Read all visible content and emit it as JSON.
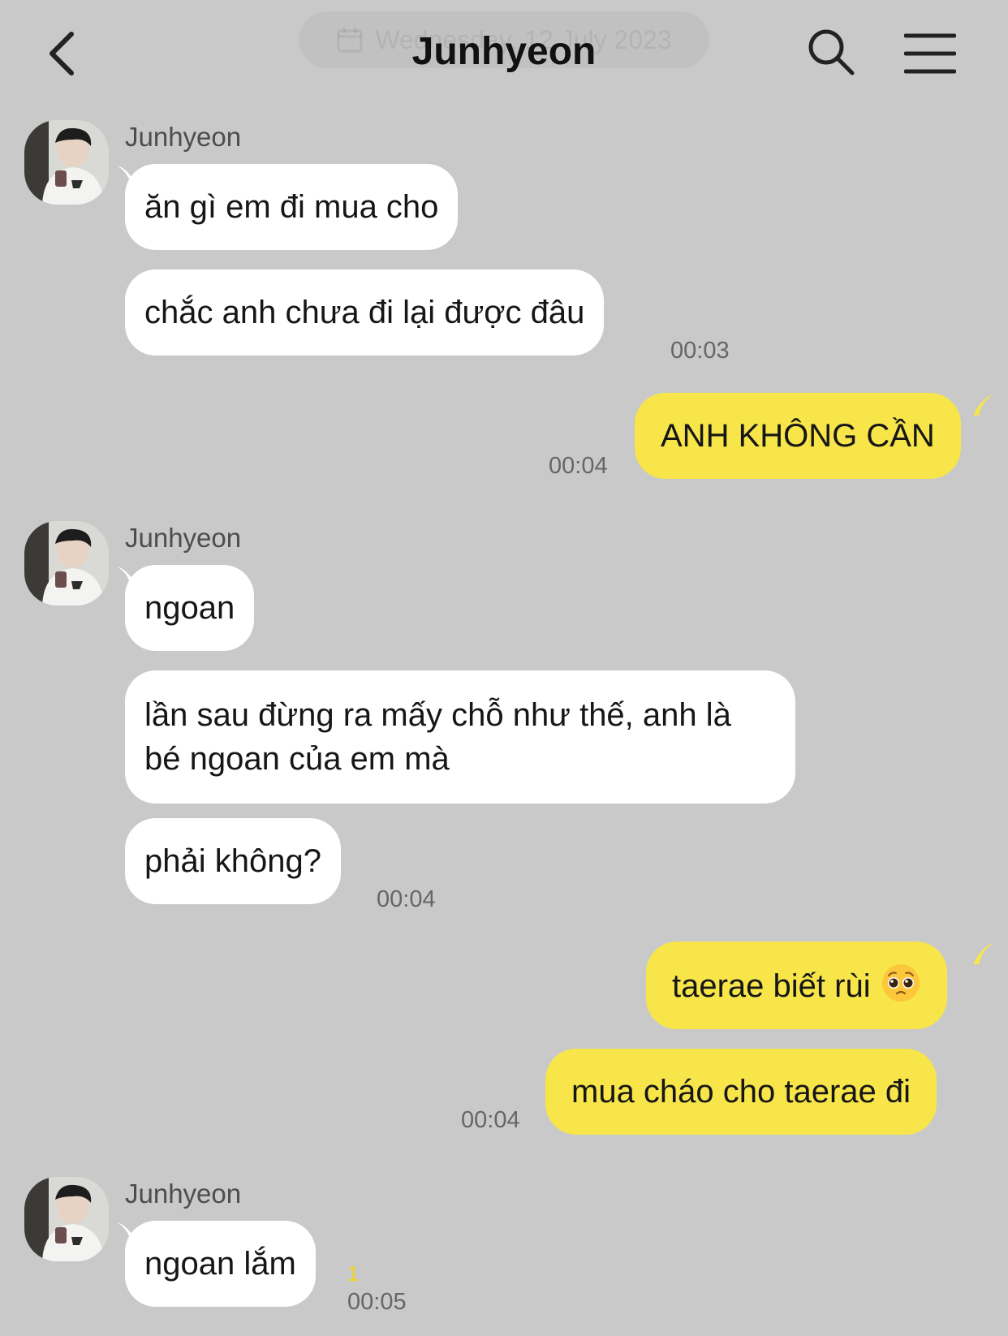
{
  "header": {
    "title": "Junhyeon",
    "date_label": "Wednesday, 12 July 2023"
  },
  "messages": {
    "m1": "ăn gì em đi mua cho",
    "m2": "chắc anh chưa đi lại được đâu",
    "m3": "ANH KHÔNG CẦN",
    "m4": "ngoan",
    "m5": "lần sau đừng ra mấy chỗ như thế, anh là bé ngoan của em mà",
    "m6": "phải không?",
    "m7": "taerae biết rùi",
    "m8": "mua cháo cho taerae đi",
    "m9": "ngoan lắm"
  },
  "sender_name": "Junhyeon",
  "times": {
    "t1": "00:03",
    "t2": "00:04",
    "t3": "00:04",
    "t4": "00:04",
    "t5": "00:05"
  },
  "unread_count": "1",
  "colors": {
    "background": "#c9c9c9",
    "incoming_bubble": "#ffffff",
    "outgoing_bubble": "#f7e54a",
    "unread": "#f2d21c"
  },
  "icons": {
    "back": "chevron-left-icon",
    "search": "search-icon",
    "menu": "hamburger-menu-icon",
    "calendar": "calendar-icon",
    "emoji": "pleading-face-emoji"
  }
}
